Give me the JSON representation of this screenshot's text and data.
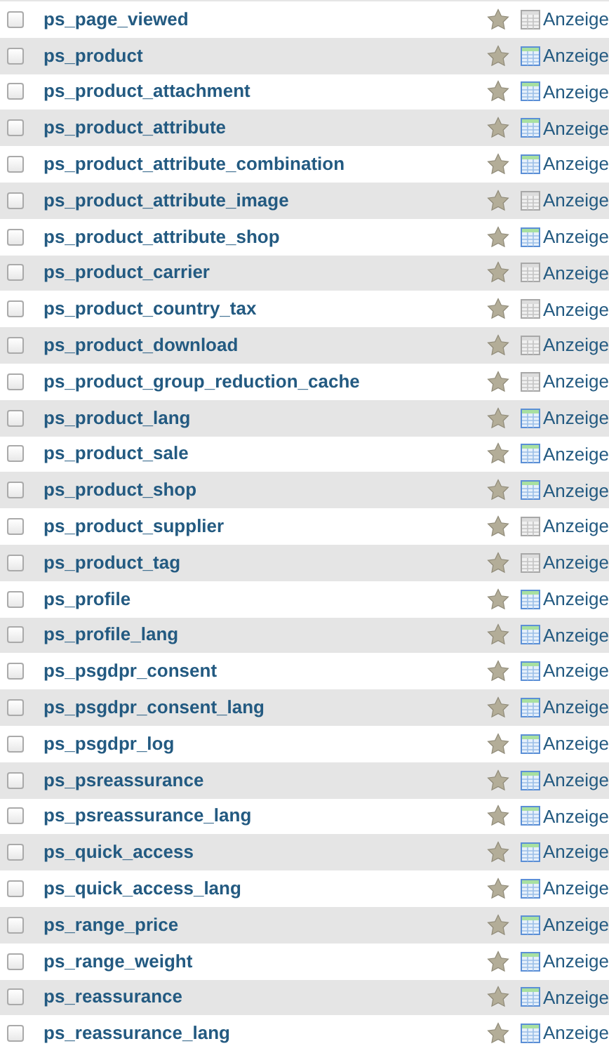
{
  "tables": [
    {
      "name": "ps_page_viewed",
      "checked": false,
      "favorite": false,
      "empty": true,
      "action": "Anzeige"
    },
    {
      "name": "ps_product",
      "checked": false,
      "favorite": false,
      "empty": false,
      "action": "Anzeige"
    },
    {
      "name": "ps_product_attachment",
      "checked": false,
      "favorite": false,
      "empty": false,
      "action": "Anzeige"
    },
    {
      "name": "ps_product_attribute",
      "checked": false,
      "favorite": false,
      "empty": false,
      "action": "Anzeige"
    },
    {
      "name": "ps_product_attribute_combination",
      "checked": false,
      "favorite": false,
      "empty": false,
      "action": "Anzeige"
    },
    {
      "name": "ps_product_attribute_image",
      "checked": false,
      "favorite": false,
      "empty": true,
      "action": "Anzeige"
    },
    {
      "name": "ps_product_attribute_shop",
      "checked": false,
      "favorite": false,
      "empty": false,
      "action": "Anzeige"
    },
    {
      "name": "ps_product_carrier",
      "checked": false,
      "favorite": false,
      "empty": true,
      "action": "Anzeige"
    },
    {
      "name": "ps_product_country_tax",
      "checked": false,
      "favorite": false,
      "empty": true,
      "action": "Anzeige"
    },
    {
      "name": "ps_product_download",
      "checked": false,
      "favorite": false,
      "empty": true,
      "action": "Anzeige"
    },
    {
      "name": "ps_product_group_reduction_cache",
      "checked": false,
      "favorite": false,
      "empty": true,
      "action": "Anzeige"
    },
    {
      "name": "ps_product_lang",
      "checked": false,
      "favorite": false,
      "empty": false,
      "action": "Anzeige"
    },
    {
      "name": "ps_product_sale",
      "checked": false,
      "favorite": false,
      "empty": false,
      "action": "Anzeige"
    },
    {
      "name": "ps_product_shop",
      "checked": false,
      "favorite": false,
      "empty": false,
      "action": "Anzeige"
    },
    {
      "name": "ps_product_supplier",
      "checked": false,
      "favorite": false,
      "empty": true,
      "action": "Anzeige"
    },
    {
      "name": "ps_product_tag",
      "checked": false,
      "favorite": false,
      "empty": true,
      "action": "Anzeige"
    },
    {
      "name": "ps_profile",
      "checked": false,
      "favorite": false,
      "empty": false,
      "action": "Anzeige"
    },
    {
      "name": "ps_profile_lang",
      "checked": false,
      "favorite": false,
      "empty": false,
      "action": "Anzeige"
    },
    {
      "name": "ps_psgdpr_consent",
      "checked": false,
      "favorite": false,
      "empty": false,
      "action": "Anzeige"
    },
    {
      "name": "ps_psgdpr_consent_lang",
      "checked": false,
      "favorite": false,
      "empty": false,
      "action": "Anzeige"
    },
    {
      "name": "ps_psgdpr_log",
      "checked": false,
      "favorite": false,
      "empty": false,
      "action": "Anzeige"
    },
    {
      "name": "ps_psreassurance",
      "checked": false,
      "favorite": false,
      "empty": false,
      "action": "Anzeige"
    },
    {
      "name": "ps_psreassurance_lang",
      "checked": false,
      "favorite": false,
      "empty": false,
      "action": "Anzeige"
    },
    {
      "name": "ps_quick_access",
      "checked": false,
      "favorite": false,
      "empty": false,
      "action": "Anzeige"
    },
    {
      "name": "ps_quick_access_lang",
      "checked": false,
      "favorite": false,
      "empty": false,
      "action": "Anzeige"
    },
    {
      "name": "ps_range_price",
      "checked": false,
      "favorite": false,
      "empty": false,
      "action": "Anzeige"
    },
    {
      "name": "ps_range_weight",
      "checked": false,
      "favorite": false,
      "empty": false,
      "action": "Anzeige"
    },
    {
      "name": "ps_reassurance",
      "checked": false,
      "favorite": false,
      "empty": false,
      "action": "Anzeige"
    },
    {
      "name": "ps_reassurance_lang",
      "checked": false,
      "favorite": false,
      "empty": false,
      "action": "Anzeige"
    }
  ]
}
